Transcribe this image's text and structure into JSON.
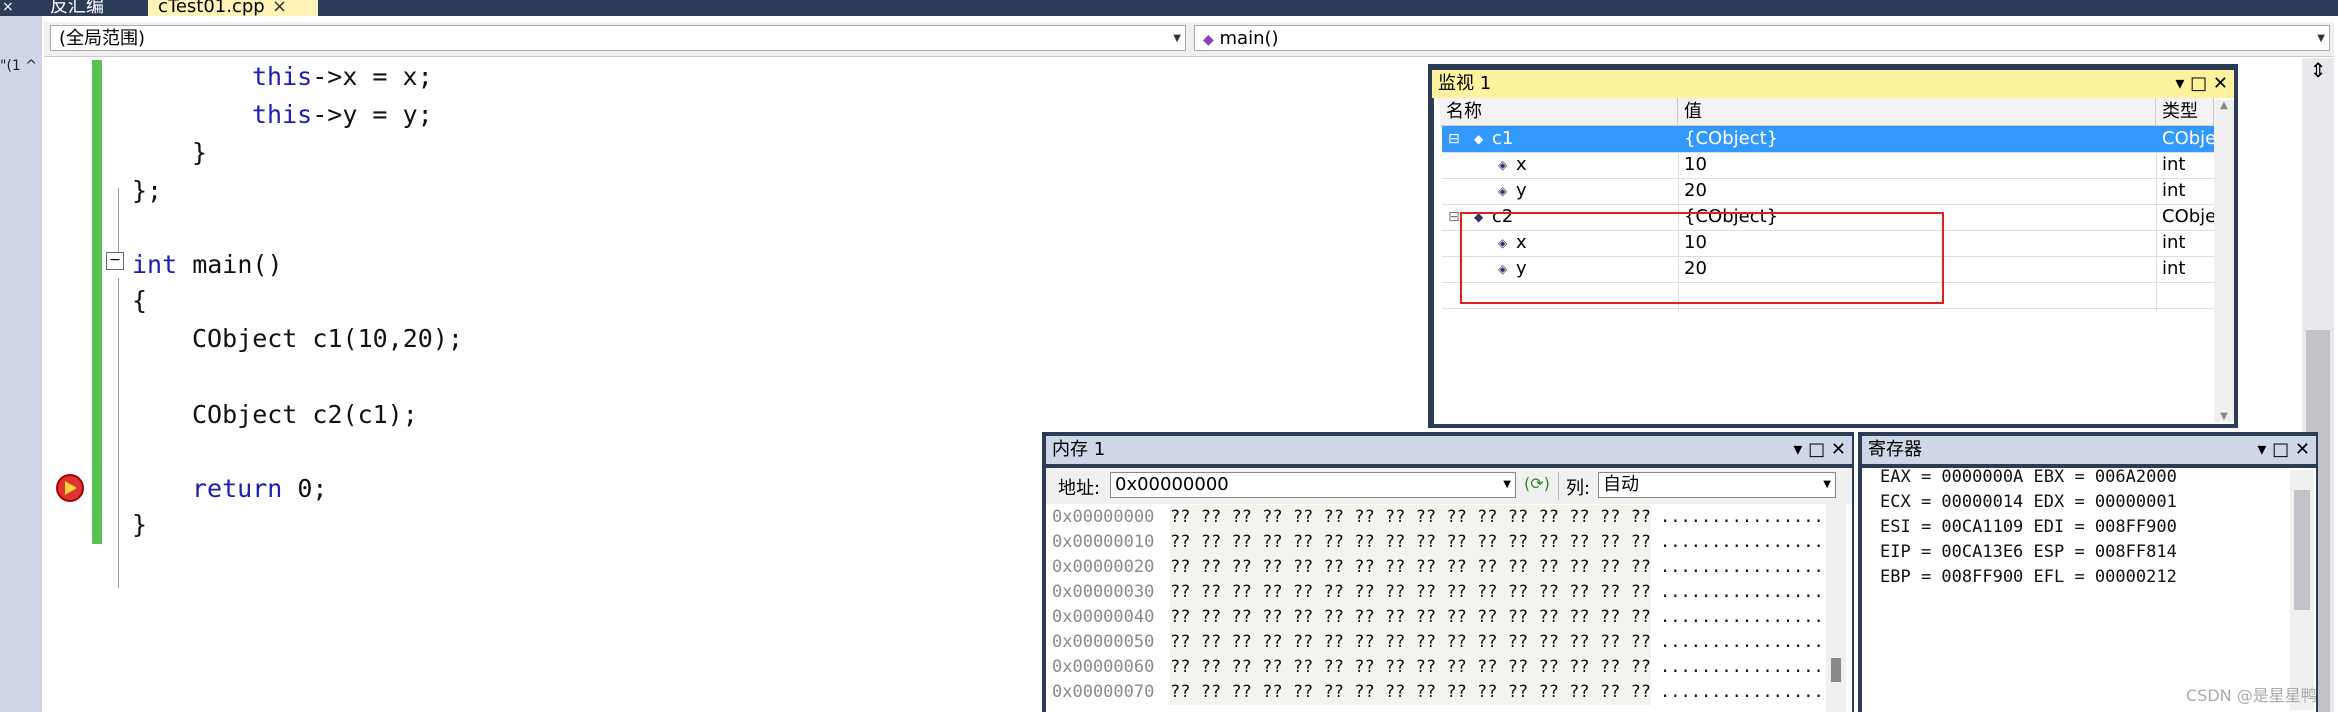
{
  "tabs": {
    "disassembly": "反汇编",
    "file": "cTest01.cpp",
    "close_glyph": "×"
  },
  "left_strip_text": "\"(1 ^",
  "navbar": {
    "scope": "(全局范围)",
    "function": "main()"
  },
  "code_lines": [
    "this->x = x;",
    "this->y = y;",
    "}",
    "};",
    "int main()",
    "{",
    "CObject c1(10,20);",
    "CObject c2(c1);",
    "return 0;",
    "}"
  ],
  "watch": {
    "title": "监视 1",
    "headers": [
      "名称",
      "值",
      "类型"
    ],
    "rows": [
      {
        "name": "c1",
        "value": "{CObject}",
        "type": "CObje"
      },
      {
        "name": "x",
        "value": "10",
        "type": "int"
      },
      {
        "name": "y",
        "value": "20",
        "type": "int"
      },
      {
        "name": "c2",
        "value": "{CObject}",
        "type": "CObje"
      },
      {
        "name": "x",
        "value": "10",
        "type": "int"
      },
      {
        "name": "y",
        "value": "20",
        "type": "int"
      }
    ]
  },
  "memory": {
    "title": "内存 1",
    "address_label": "地址:",
    "address_value": "0x00000000",
    "columns_label": "列:",
    "columns_value": "自动",
    "rows": [
      {
        "addr": "0x00000000",
        "hex": "?? ?? ?? ?? ?? ?? ?? ?? ?? ?? ?? ?? ?? ?? ?? ??",
        "ascii": "................"
      },
      {
        "addr": "0x00000010",
        "hex": "?? ?? ?? ?? ?? ?? ?? ?? ?? ?? ?? ?? ?? ?? ?? ??",
        "ascii": "................"
      },
      {
        "addr": "0x00000020",
        "hex": "?? ?? ?? ?? ?? ?? ?? ?? ?? ?? ?? ?? ?? ?? ?? ??",
        "ascii": "................"
      },
      {
        "addr": "0x00000030",
        "hex": "?? ?? ?? ?? ?? ?? ?? ?? ?? ?? ?? ?? ?? ?? ?? ??",
        "ascii": "................"
      },
      {
        "addr": "0x00000040",
        "hex": "?? ?? ?? ?? ?? ?? ?? ?? ?? ?? ?? ?? ?? ?? ?? ??",
        "ascii": "................"
      },
      {
        "addr": "0x00000050",
        "hex": "?? ?? ?? ?? ?? ?? ?? ?? ?? ?? ?? ?? ?? ?? ?? ??",
        "ascii": "................"
      },
      {
        "addr": "0x00000060",
        "hex": "?? ?? ?? ?? ?? ?? ?? ?? ?? ?? ?? ?? ?? ?? ?? ??",
        "ascii": "................"
      },
      {
        "addr": "0x00000070",
        "hex": "?? ?? ?? ?? ?? ?? ?? ?? ?? ?? ?? ?? ?? ?? ?? ??",
        "ascii": "................"
      }
    ]
  },
  "registers": {
    "title": "寄存器",
    "lines": [
      "EAX = 0000000A EBX = 006A2000",
      "ECX = 00000014 EDX = 00000001",
      "ESI = 00CA1109 EDI = 008FF900",
      "EIP = 00CA13E6 ESP = 008FF814",
      "EBP = 008FF900 EFL = 00000212"
    ]
  },
  "window_buttons": {
    "dropdown": "▾",
    "maximize": "□",
    "close": "✕"
  },
  "watermark": "CSDN @是星星鸭",
  "colors": {
    "frame": "#2d3c56",
    "watch_title": "#fff29d",
    "selection": "#3399ff",
    "highlight_box": "#e02020",
    "keyword": "#1c1cb8",
    "change_bar": "#58c254"
  }
}
